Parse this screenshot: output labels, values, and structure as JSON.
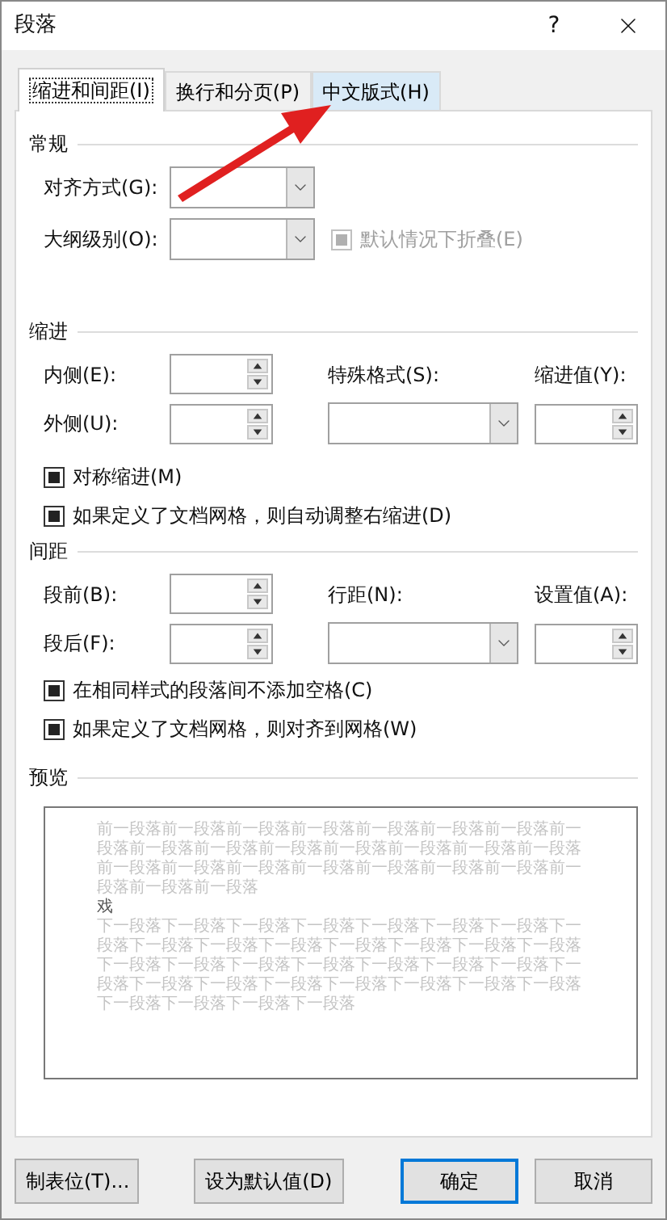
{
  "window": {
    "title": "段落",
    "help": "?"
  },
  "tabs": [
    {
      "label": "缩进和间距(I)",
      "selected": true,
      "highlighted": false
    },
    {
      "label": "换行和分页(P)",
      "selected": false,
      "highlighted": false
    },
    {
      "label": "中文版式(H)",
      "selected": false,
      "highlighted": true
    }
  ],
  "general": {
    "heading": "常规",
    "alignment": {
      "label": "对齐方式(G):"
    },
    "outline_level": {
      "label": "大纲级别(O):"
    },
    "collapse": {
      "label": "默认情况下折叠(E)",
      "indeterminate": true,
      "disabled": true
    }
  },
  "indentation": {
    "heading": "缩进",
    "inside": {
      "label": "内侧(E):"
    },
    "outside": {
      "label": "外侧(U):"
    },
    "special": {
      "label": "特殊格式(S):"
    },
    "by": {
      "label": "缩进值(Y):"
    },
    "options": [
      {
        "label": "对称缩进(M)",
        "indeterminate": true,
        "disabled": false
      },
      {
        "label": "如果定义了文档网格，则自动调整右缩进(D)",
        "indeterminate": true,
        "disabled": false
      }
    ]
  },
  "spacing": {
    "heading": "间距",
    "before": {
      "label": "段前(B):"
    },
    "after": {
      "label": "段后(F):"
    },
    "line_spacing": {
      "label": "行距(N):"
    },
    "at": {
      "label": "设置值(A):"
    },
    "options": [
      {
        "label": "在相同样式的段落间不添加空格(C)",
        "indeterminate": true,
        "disabled": false
      },
      {
        "label": "如果定义了文档网格，则对齐到网格(W)",
        "indeterminate": true,
        "disabled": false
      }
    ]
  },
  "preview": {
    "heading": "预览",
    "previous_text": "前一段落前一段落前一段落前一段落前一段落前一段落前一段落前一段落前一段落前一段落前一段落前一段落前一段落前一段落前一段落前一段落前一段落前一段落前一段落前一段落前一段落前一段落前一段落前一段落前一段落",
    "sample_text": "戏",
    "next_text": "下一段落下一段落下一段落下一段落下一段落下一段落下一段落下一段落下一段落下一段落下一段落下一段落下一段落下一段落下一段落下一段落下一段落下一段落下一段落下一段落下一段落下一段落下一段落下一段落下一段落下一段落下一段落下一段落下一段落下一段落下一段落下一段落下一段落下一段落"
  },
  "buttons": [
    {
      "label": "制表位(T)...",
      "focused": false
    },
    {
      "label": "设为默认值(D)",
      "focused": false
    },
    {
      "label": "确定",
      "focused": true
    },
    {
      "label": "取消",
      "focused": false
    }
  ]
}
